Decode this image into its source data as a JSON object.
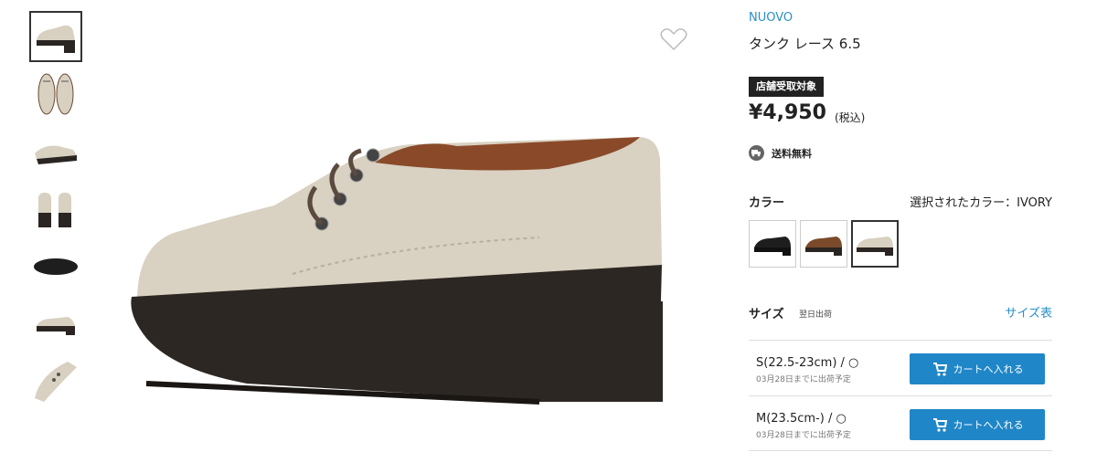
{
  "product": {
    "brand": "NUOVO",
    "name": "タンク レース 6.5",
    "badge": "店舗受取対象",
    "price": "¥4,950",
    "tax_note": "(税込)",
    "shipping": "送料無料"
  },
  "color": {
    "title": "カラー",
    "selected_text": "選択されたカラー：IVORY",
    "swatches": [
      {
        "name": "black",
        "hex": "#1e1e1e"
      },
      {
        "name": "brown",
        "hex": "#7a4a2a"
      },
      {
        "name": "ivory",
        "hex": "#d8d0c0"
      }
    ]
  },
  "size": {
    "title": "サイズ",
    "note": "翌日出荷",
    "chart_link": "サイズ表",
    "rows": [
      {
        "label": "S(22.5-23cm) / ○",
        "eta": "03月28日までに出荷予定",
        "button": "カートへ入れる"
      },
      {
        "label": "M(23.5cm-) / ○",
        "eta": "03月28日までに出荷予定",
        "button": "カートへ入れる"
      }
    ]
  },
  "icons": {
    "favorite": "heart-icon",
    "shipping": "truck-icon",
    "cart": "cart-icon"
  },
  "colors": {
    "accent": "#2a8fc9",
    "button": "#1f86c8",
    "badge_bg": "#222222"
  }
}
